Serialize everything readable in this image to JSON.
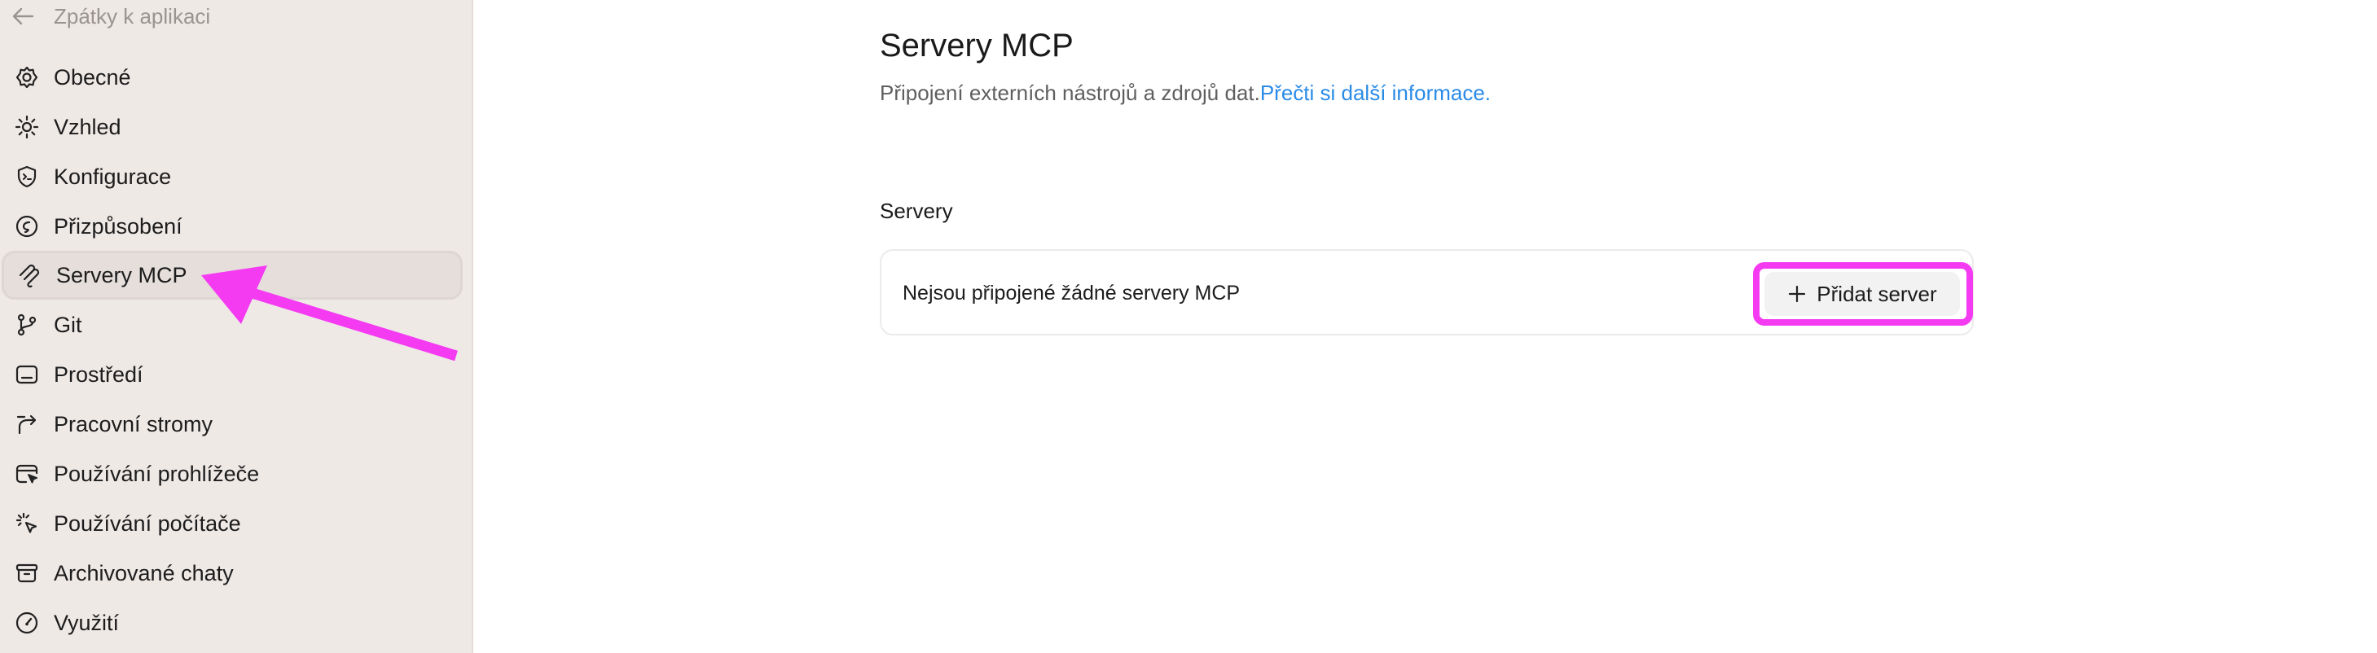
{
  "sidebar": {
    "back_label": "Zpátky k aplikaci",
    "items": [
      {
        "label": "Obecné",
        "icon": "gear-icon"
      },
      {
        "label": "Vzhled",
        "icon": "sun-icon"
      },
      {
        "label": "Konfigurace",
        "icon": "shield-code-icon"
      },
      {
        "label": "Přizpůsobení",
        "icon": "personalize-icon"
      },
      {
        "label": "Servery MCP",
        "icon": "mcp-icon",
        "active": true
      },
      {
        "label": "Git",
        "icon": "git-branch-icon"
      },
      {
        "label": "Prostředí",
        "icon": "terminal-window-icon"
      },
      {
        "label": "Pracovní stromy",
        "icon": "worktree-icon"
      },
      {
        "label": "Používání prohlížeče",
        "icon": "browser-cursor-icon"
      },
      {
        "label": "Používání počítače",
        "icon": "pointer-click-icon"
      },
      {
        "label": "Archivované chaty",
        "icon": "archive-icon"
      },
      {
        "label": "Využití",
        "icon": "gauge-icon"
      }
    ]
  },
  "main": {
    "title": "Servery MCP",
    "subtitle": "Připojení externích nástrojů a zdrojů dat.",
    "learn_more": "Přečti si další informace.",
    "section_title": "Servery",
    "empty_text": "Nejsou připojené žádné servery MCP",
    "add_button": "Přidat server"
  },
  "colors": {
    "annotation": "#f43bf2",
    "link": "#2a8be6",
    "sidebar_bg": "#efe9e6"
  }
}
